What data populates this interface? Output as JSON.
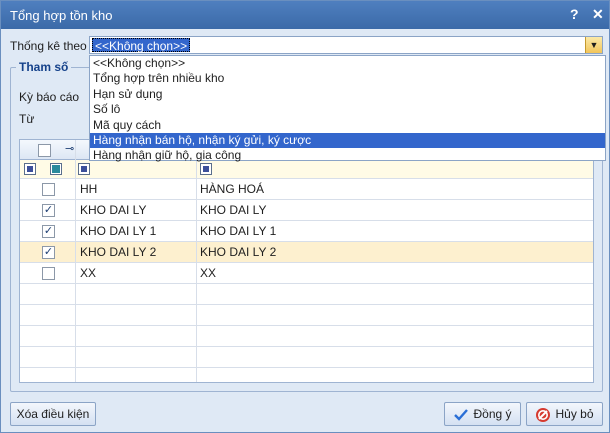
{
  "window": {
    "title": "Tổng hợp tồn kho",
    "help": "?",
    "close": "✕"
  },
  "group_by": {
    "label": "Thống kê theo",
    "selected": "<<Không chọn>>",
    "options": [
      "<<Không chọn>>",
      "Tổng hợp trên nhiều kho",
      "Hạn sử dụng",
      "Số lô",
      "Mã quy cách",
      "Hàng nhận bán hộ, nhận ký gửi, ký cược",
      "Hàng nhận giữ hộ, gia công"
    ],
    "highlighted_index": 5
  },
  "params": {
    "title": "Tham số",
    "period_label": "Kỳ báo cáo",
    "from_label": "Từ"
  },
  "grid": {
    "rows": [
      {
        "checked": false,
        "code": "HH",
        "name": "HÀNG HOÁ"
      },
      {
        "checked": true,
        "code": "KHO DAI LY",
        "name": "KHO DAI LY"
      },
      {
        "checked": true,
        "code": "KHO DAI LY 1",
        "name": "KHO DAI LY 1"
      },
      {
        "checked": true,
        "code": "KHO DAI LY 2",
        "name": "KHO DAI LY 2",
        "highlight": true
      },
      {
        "checked": false,
        "code": "XX",
        "name": "XX"
      }
    ]
  },
  "buttons": {
    "clear": "Xóa điều kiện",
    "ok": "Đồng ý",
    "cancel": "Hủy bỏ"
  },
  "colors": {
    "accent": "#3366cc",
    "titlebar": "#3b6aa8",
    "row_highlight": "#fdf0cf"
  }
}
